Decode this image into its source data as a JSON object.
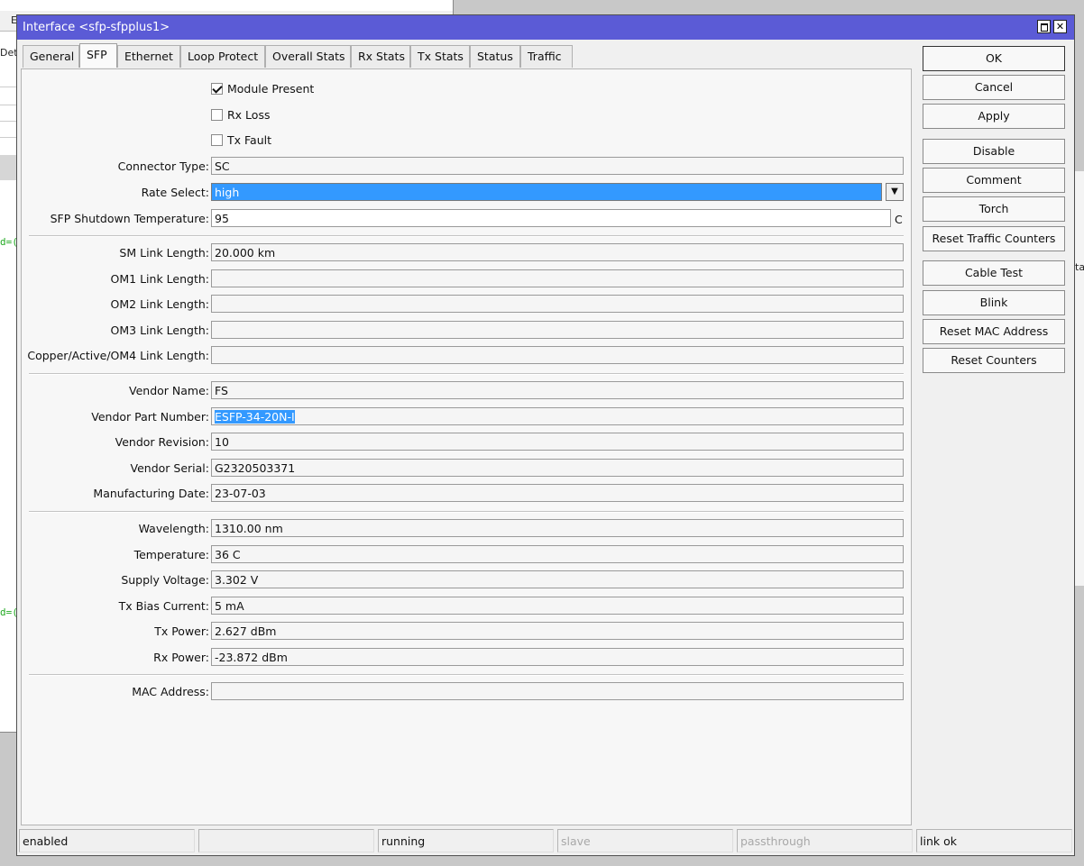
{
  "window": {
    "title": "Interface <sfp-sfpplus1>"
  },
  "background": {
    "snippet_det": "Det",
    "snippet_e": "E",
    "green_1": "d=(",
    "green_2": "d=(",
    "snippet_ta": "ta"
  },
  "tabs": [
    "General",
    "SFP",
    "Ethernet",
    "Loop Protect",
    "Overall Stats",
    "Rx Stats",
    "Tx Stats",
    "Status",
    "Traffic"
  ],
  "active_tab": "SFP",
  "checkboxes": [
    {
      "label": "Module Present",
      "checked": true
    },
    {
      "label": "Rx Loss",
      "checked": false
    },
    {
      "label": "Tx Fault",
      "checked": false
    }
  ],
  "fields": {
    "connector_type": {
      "label": "Connector Type:",
      "value": "SC"
    },
    "rate_select": {
      "label": "Rate Select:",
      "value": "high"
    },
    "shutdown_temp": {
      "label": "SFP Shutdown Temperature:",
      "value": "95",
      "unit": "C"
    },
    "sm_link": {
      "label": "SM Link Length:",
      "value": "20.000 km"
    },
    "om1_link": {
      "label": "OM1 Link Length:",
      "value": ""
    },
    "om2_link": {
      "label": "OM2 Link Length:",
      "value": ""
    },
    "om3_link": {
      "label": "OM3 Link Length:",
      "value": ""
    },
    "copper_link": {
      "label": "Copper/Active/OM4 Link Length:",
      "value": ""
    },
    "vendor_name": {
      "label": "Vendor Name:",
      "value": "FS"
    },
    "vendor_part": {
      "label": "Vendor Part Number:",
      "value": "ESFP-34-20N-I"
    },
    "vendor_rev": {
      "label": "Vendor Revision:",
      "value": "10"
    },
    "vendor_serial": {
      "label": "Vendor Serial:",
      "value": "G2320503371"
    },
    "mfg_date": {
      "label": "Manufacturing Date:",
      "value": "23-07-03"
    },
    "wavelength": {
      "label": "Wavelength:",
      "value": "1310.00 nm"
    },
    "temperature": {
      "label": "Temperature:",
      "value": "36 C"
    },
    "supply_voltage": {
      "label": "Supply Voltage:",
      "value": "3.302 V"
    },
    "tx_bias": {
      "label": "Tx Bias Current:",
      "value": "5 mA"
    },
    "tx_power": {
      "label": "Tx Power:",
      "value": "2.627 dBm"
    },
    "rx_power": {
      "label": "Rx Power:",
      "value": "-23.872 dBm"
    },
    "mac_address": {
      "label": "MAC Address:",
      "value": ""
    }
  },
  "buttons": {
    "ok": "OK",
    "cancel": "Cancel",
    "apply": "Apply",
    "disable": "Disable",
    "comment": "Comment",
    "torch": "Torch",
    "reset_traffic": "Reset Traffic Counters",
    "cable_test": "Cable Test",
    "blink": "Blink",
    "reset_mac": "Reset MAC Address",
    "reset_counters": "Reset Counters"
  },
  "status_bar": [
    "enabled",
    "",
    "running",
    "slave",
    "passthrough",
    "link ok"
  ],
  "colors": {
    "titlebar": "#5b5bd6",
    "selection": "#3399ff"
  }
}
